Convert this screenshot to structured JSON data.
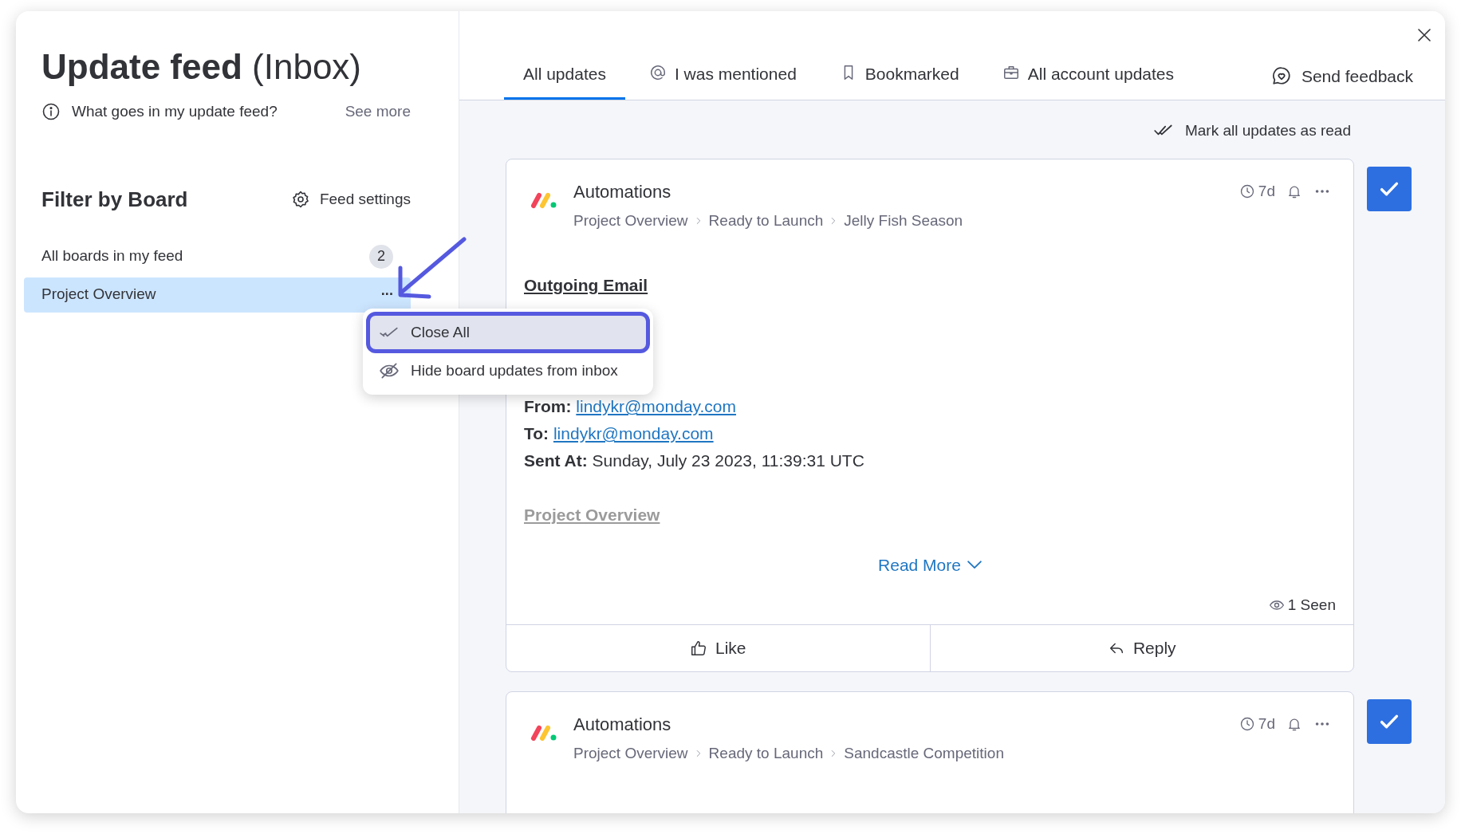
{
  "title": {
    "main": "Update feed",
    "sub": "(Inbox)"
  },
  "info": {
    "text": "What goes in my update feed?",
    "link": "See more"
  },
  "filter": {
    "heading": "Filter by Board",
    "settings": "Feed settings"
  },
  "boards": [
    {
      "label": "All boards in my feed",
      "count": "2",
      "selected": false
    },
    {
      "label": "Project Overview",
      "more": "···",
      "selected": true
    }
  ],
  "menu": [
    {
      "label": "Close All",
      "highlighted": true
    },
    {
      "label": "Hide board updates from inbox",
      "highlighted": false
    }
  ],
  "tabs": [
    {
      "label": "All updates",
      "selected": true
    },
    {
      "label": "I was mentioned",
      "selected": false
    },
    {
      "label": "Bookmarked",
      "selected": false
    },
    {
      "label": "All account updates",
      "selected": false
    }
  ],
  "feedback": "Send feedback",
  "mark_all": "Mark all updates as read",
  "updates": [
    {
      "author": "Automations",
      "breadcrumb": [
        "Project Overview",
        "Ready to Launch",
        "Jelly Fish Season"
      ],
      "time": "7d",
      "checked": true,
      "body": [
        {
          "kind": "heading",
          "text": "Outgoing Email"
        },
        {
          "kind": "spacer"
        },
        {
          "kind": "field",
          "label": "From:",
          "value": "lindykr@monday.com",
          "link": true
        },
        {
          "kind": "field",
          "label": "To:",
          "value": "lindykr@monday.com",
          "link": true
        },
        {
          "kind": "field",
          "label": "Sent At:",
          "value": "Sunday, July 23 2023, 11:39:31 UTC",
          "link": false
        },
        {
          "kind": "muted_link",
          "text": "Project Overview"
        }
      ],
      "read_more": "Read More",
      "seen": "1 Seen",
      "actions": [
        "Like",
        "Reply"
      ]
    },
    {
      "author": "Automations",
      "breadcrumb": [
        "Project Overview",
        "Ready to Launch",
        "Sandcastle Competition"
      ],
      "time": "7d",
      "checked": true
    }
  ]
}
